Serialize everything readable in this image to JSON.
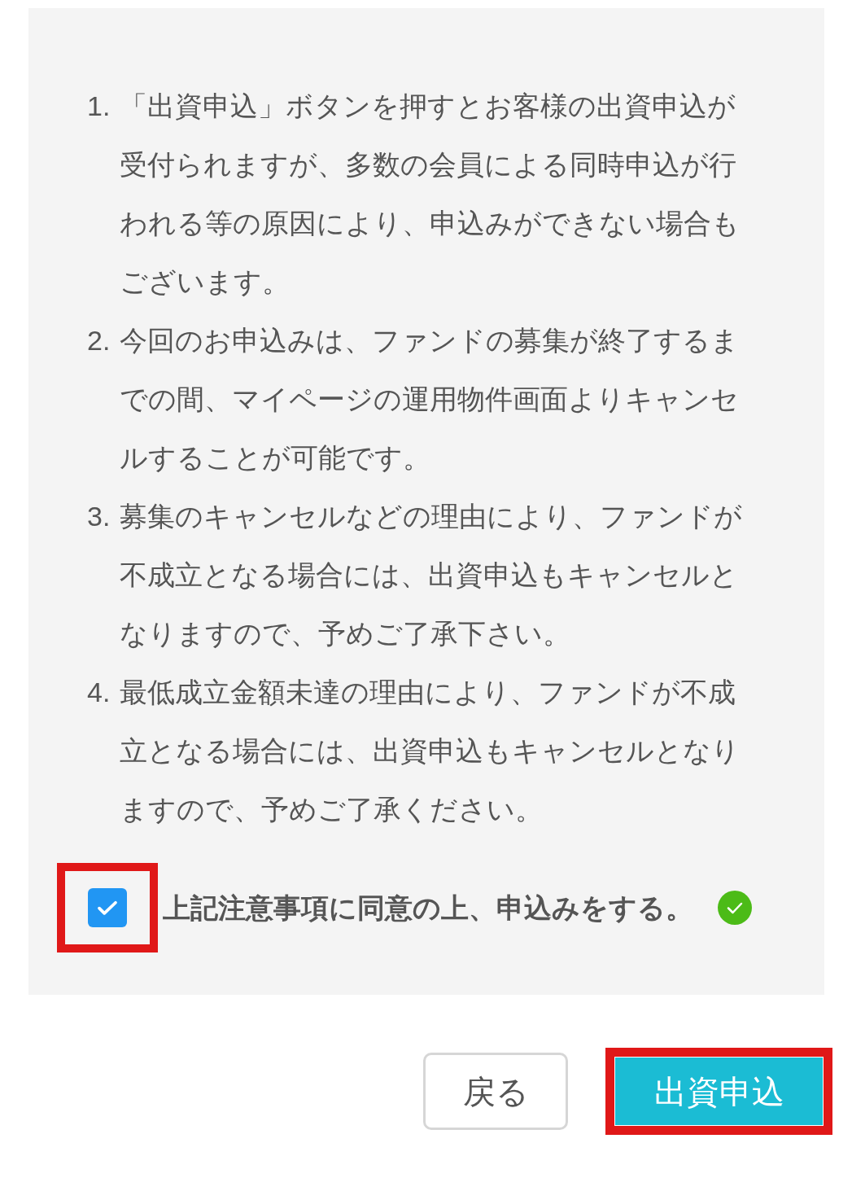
{
  "notes": [
    {
      "number": "1.",
      "text": "「出資申込」ボタンを押すとお客様の出資申込が受付られますが、多数の会員による同時申込が行われる等の原因により、申込みができない場合もございます。"
    },
    {
      "number": "2.",
      "text": "今回のお申込みは、ファンドの募集が終了するまでの間、マイページの運用物件画面よりキャンセルすることが可能です。"
    },
    {
      "number": "3.",
      "text": "募集のキャンセルなどの理由により、ファンドが不成立となる場合には、出資申込もキャンセルとなりますので、予めご了承下さい。"
    },
    {
      "number": "4.",
      "text": "最低成立金額未達の理由により、ファンドが不成立となる場合には、出資申込もキャンセルとなりますので、予めご了承ください。"
    }
  ],
  "agreement": {
    "label": "上記注意事項に同意の上、申込みをする。",
    "checked": true,
    "confirmed": true,
    "highlighted": true
  },
  "buttons": [
    {
      "kind": "secondary",
      "label": "戻る",
      "highlighted": false
    },
    {
      "kind": "primary",
      "label": "出資申込",
      "highlighted": true
    }
  ]
}
